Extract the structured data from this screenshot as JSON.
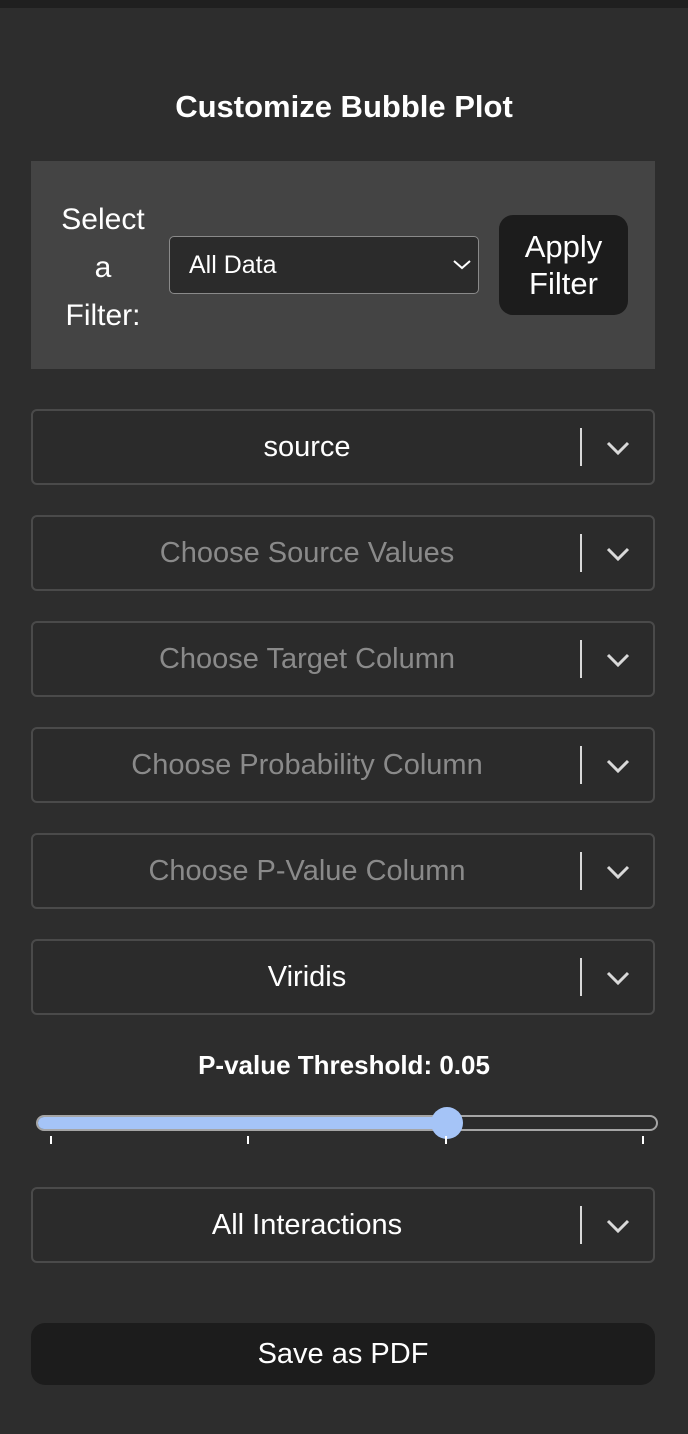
{
  "panel": {
    "title": "Customize Bubble Plot"
  },
  "filter": {
    "label_line1": "Select",
    "label_line2": "a",
    "label_line3": "Filter:",
    "selected": "All Data",
    "apply_line1": "Apply",
    "apply_line2": "Filter"
  },
  "dropdowns": [
    {
      "text": "source",
      "placeholder": false
    },
    {
      "text": "Choose Source Values",
      "placeholder": true
    },
    {
      "text": "Choose Target Column",
      "placeholder": true
    },
    {
      "text": "Choose Probability Column",
      "placeholder": true
    },
    {
      "text": "Choose P-Value Column",
      "placeholder": true
    },
    {
      "text": "Viridis",
      "placeholder": false
    }
  ],
  "slider": {
    "label": "P-value Threshold: 0.05",
    "value_fraction": 0.67,
    "tick_count": 4
  },
  "interactions": {
    "text": "All Interactions",
    "placeholder": false
  },
  "save": {
    "label": "Save as PDF"
  },
  "colors": {
    "background": "#2d2d2d",
    "filter_box": "#444444",
    "button": "#1c1c1c",
    "accent": "#a5c4f7",
    "placeholder_text": "#8a8a8a"
  },
  "icons": {
    "dropdown_arrow": "chevron-down-icon",
    "select_arrow": "chevron-down-icon"
  }
}
